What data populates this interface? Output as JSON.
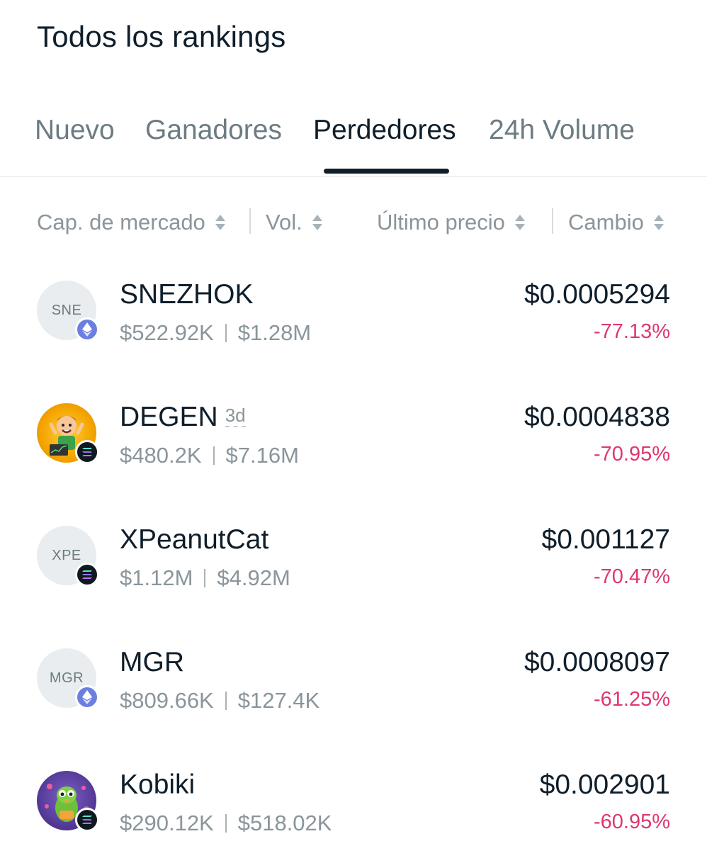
{
  "header": {
    "title": "Todos los rankings"
  },
  "tabs": [
    {
      "label": "Nuevo",
      "active": false
    },
    {
      "label": "Ganadores",
      "active": false
    },
    {
      "label": "Perdedores",
      "active": true
    },
    {
      "label": "24h Volume",
      "active": false
    }
  ],
  "sort_bar": {
    "market_cap": "Cap. de mercado",
    "volume": "Vol.",
    "last_price": "Último precio",
    "change": "Cambio"
  },
  "colors": {
    "negative_change": "#e0366f",
    "primary_text": "#0f1e2a",
    "secondary_text": "#8a959b"
  },
  "tokens": [
    {
      "name": "SNEZHOK",
      "avatar_text": "SNE",
      "chain_icon": "ethereum-icon",
      "market_cap": "$522.92K",
      "volume": "$1.28M",
      "price": "$0.0005294",
      "change": "-77.13%"
    },
    {
      "name": "DEGEN",
      "age": "3d",
      "avatar_text": "",
      "avatar_image": "degen-logo",
      "chain_icon": "solana-icon",
      "market_cap": "$480.2K",
      "volume": "$7.16M",
      "price": "$0.0004838",
      "change": "-70.95%"
    },
    {
      "name": "XPeanutCat",
      "avatar_text": "XPE",
      "chain_icon": "solana-icon",
      "market_cap": "$1.12M",
      "volume": "$4.92M",
      "price": "$0.001127",
      "change": "-70.47%"
    },
    {
      "name": "MGR",
      "avatar_text": "MGR",
      "chain_icon": "ethereum-icon",
      "market_cap": "$809.66K",
      "volume": "$127.4K",
      "price": "$0.0008097",
      "change": "-61.25%"
    },
    {
      "name": "Kobiki",
      "avatar_text": "",
      "avatar_image": "kobiki-logo",
      "chain_icon": "solana-icon",
      "market_cap": "$290.12K",
      "volume": "$518.02K",
      "price": "$0.002901",
      "change": "-60.95%"
    }
  ]
}
